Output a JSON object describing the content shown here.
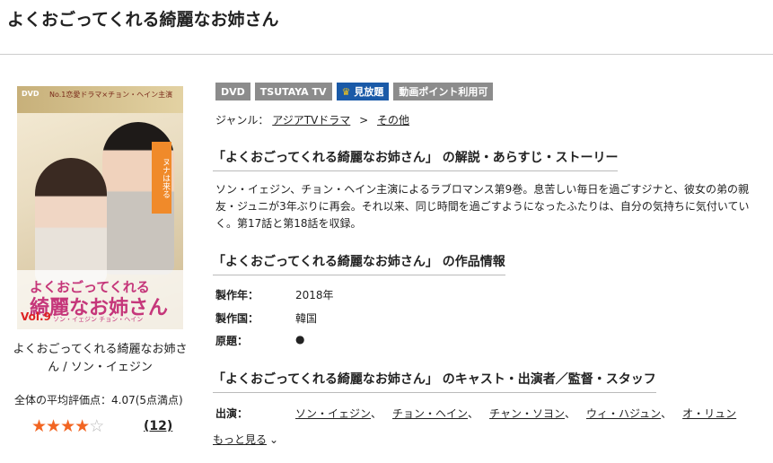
{
  "page": {
    "title": "よくおごってくれる綺麗なお姉さん"
  },
  "cover": {
    "dvd": "DVD",
    "tagline": "No.1恋愛ドラマ×チョン・ヘイン主演",
    "subtitle": "ヌナは来る",
    "logo_line1": "よくおごってくれる",
    "logo_line2": "綺麗なお姉さん",
    "vol": "Vol.9",
    "cast": "ソン・イェジン  チョン・ヘイン"
  },
  "sidebar": {
    "work_name": "よくおごってくれる綺麗なお姉さん / ソン・イェジン",
    "avg_rating_text": "全体の平均評価点：4.07(5点満点)",
    "rating_value": 4.07,
    "rating_max": 5,
    "stars": [
      "★",
      "★",
      "★",
      "★",
      "☆"
    ],
    "review_count": "(12)"
  },
  "badges": [
    {
      "label": "DVD",
      "icon": "",
      "kind": "plain"
    },
    {
      "label": "TSUTAYA TV",
      "icon": "",
      "kind": "plain"
    },
    {
      "label": "見放題",
      "icon": "crown-icon",
      "kind": "premium"
    },
    {
      "label": "動画ポイント利用可",
      "icon": "",
      "kind": "plain"
    }
  ],
  "genre": {
    "label": "ジャンル：",
    "items": [
      "アジアTVドラマ",
      "その他"
    ],
    "separator": ">"
  },
  "synopsis": {
    "heading": "「よくおごってくれる綺麗なお姉さん」 の解説・あらすじ・ストーリー",
    "text": "ソン・イェジン、チョン・ヘイン主演によるラブロマンス第9巻。息苦しい毎日を過ごすジナと、彼女の弟の親友・ジュニが3年ぶりに再会。それ以来、同じ時間を過ごすようになったふたりは、自分の気持ちに気付いていく。第17話と第18話を収録。"
  },
  "info": {
    "heading": "「よくおごってくれる綺麗なお姉さん」 の作品情報",
    "rows": [
      {
        "label": "製作年：",
        "value": "2018年"
      },
      {
        "label": "製作国：",
        "value": "韓国"
      },
      {
        "label": "原題：",
        "value": "●"
      }
    ]
  },
  "cast": {
    "heading": "「よくおごってくれる綺麗なお姉さん」 のキャスト・出演者／監督・スタッフ",
    "label": "出演：",
    "members": [
      "ソン・イェジン",
      "チョン・ヘイン",
      "チャン・ソヨン",
      "ウィ・ハジュン",
      "オ・リュン"
    ],
    "separator": "、",
    "more": "もっと見る"
  },
  "colors": {
    "badge_gray": "#8c8c8c",
    "badge_premium": "#1a5aa8",
    "star": "#f26522"
  }
}
